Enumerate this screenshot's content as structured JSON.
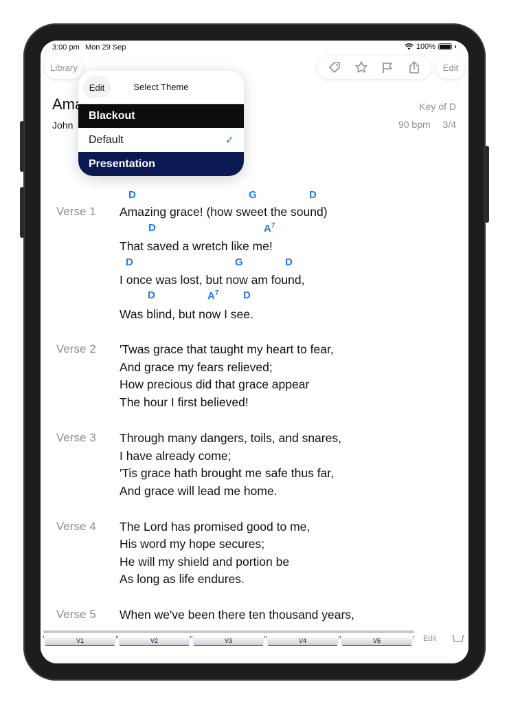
{
  "status": {
    "time": "3:00 pm",
    "date": "Mon 29 Sep",
    "battery": "100%"
  },
  "toolbar": {
    "library_label": "Library",
    "edit_label": "Edit",
    "icons": [
      "tag-icon",
      "star-icon",
      "flag-icon",
      "share-icon"
    ]
  },
  "song": {
    "title": "Ama",
    "artist": "John",
    "key": "Key of D",
    "bpm": "90 bpm",
    "time_signature": "3/4"
  },
  "theme_popover": {
    "edit_label": "Edit",
    "title": "Select Theme",
    "options": [
      {
        "label": "Blackout",
        "selected": false
      },
      {
        "label": "Default",
        "selected": true
      },
      {
        "label": "Presentation",
        "selected": false
      }
    ],
    "check_mark": "✓"
  },
  "verses": [
    {
      "label": "Verse 1",
      "lines": [
        "Amazing grace! (how sweet the sound)",
        "That saved a wretch like me!",
        "I once was lost, but now am found,",
        "Was blind, but now I see."
      ],
      "chords": [
        [
          "D",
          "G",
          "D"
        ],
        [
          "D",
          "A",
          "7"
        ],
        [
          "D",
          "G",
          "D"
        ],
        [
          "D",
          "A",
          "7",
          "D"
        ]
      ]
    },
    {
      "label": "Verse 2",
      "lines": [
        "'Twas grace that taught my heart to fear,",
        "And grace my fears relieved;",
        "How precious did that grace appear",
        "The hour I first believed!"
      ]
    },
    {
      "label": "Verse 3",
      "lines": [
        "Through many dangers, toils, and snares,",
        "I have already come;",
        "'Tis grace hath brought me safe thus far,",
        "And grace will lead me home."
      ]
    },
    {
      "label": "Verse 4",
      "lines": [
        "The Lord has promised good to me,",
        "His word my hope secures;",
        "He will my shield and portion be",
        "As long as life endures."
      ]
    },
    {
      "label": "Verse 5",
      "lines": [
        "When we've been there ten thousand years,"
      ]
    }
  ],
  "bottom_bar": {
    "tabs": [
      "V1",
      "V2",
      "V3",
      "V4",
      "V5"
    ],
    "edit_label": "Edit"
  },
  "colors": {
    "chord": "#1a7cf0",
    "blackout_bg": "#0d0d0d",
    "presentation_bg": "#0b1a52",
    "muted": "#8e8e93"
  }
}
